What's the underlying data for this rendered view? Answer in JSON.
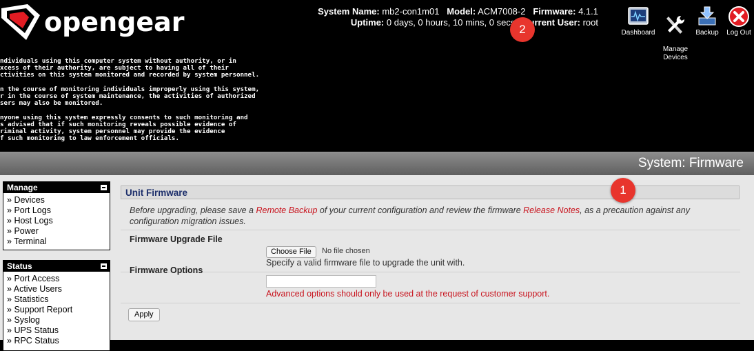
{
  "brand": {
    "name": "opengear"
  },
  "system": {
    "name_label": "System Name:",
    "name_value": "mb2-con1m01",
    "model_label": "Model:",
    "model_value": "ACM7008-2",
    "firmware_label": "Firmware:",
    "firmware_value": "4.1.1",
    "uptime_label": "Uptime:",
    "uptime_value": "0 days, 0 hours, 10 mins, 0 secs",
    "user_label": "Current User:",
    "user_value": "root"
  },
  "toolbar": [
    {
      "label": "Dashboard",
      "icon": "dashboard-icon"
    },
    {
      "label": "Manage\nDevices",
      "icon": "wrench-screwdriver-icon"
    },
    {
      "label": "Backup",
      "icon": "backup-icon"
    },
    {
      "label": "Log Out",
      "icon": "logout-icon"
    }
  ],
  "banner": "ndividuals using this computer system without authority, or in\nxcess of their authority, are subject to having all of their\nctivities on this system monitored and recorded by system personnel.\n\nn the course of monitoring individuals improperly using this system,\nr in the course of system maintenance, the activities of authorized\nsers may also be monitored.\n\nnyone using this system expressly consents to such monitoring and\ns advised that if such monitoring reveals possible evidence of\nriminal activity, system personnel may provide the evidence\nf such monitoring to law enforcement officials.",
  "page_title": "System: Firmware",
  "menus": {
    "manage": {
      "title": "Manage",
      "items": [
        "Devices",
        "Port Logs",
        "Host Logs",
        "Power",
        "Terminal"
      ]
    },
    "status": {
      "title": "Status",
      "items": [
        "Port Access",
        "Active Users",
        "Statistics",
        "Support Report",
        "Syslog",
        "UPS Status",
        "RPC Status"
      ]
    }
  },
  "firmware": {
    "section_title": "Unit Firmware",
    "intro_before": "Before upgrading, please save a ",
    "intro_link1": "Remote Backup",
    "intro_mid": " of your current configuration and review the firmware ",
    "intro_link2": "Release Notes",
    "intro_after": ", as a precaution against any configuration migration issues.",
    "upgrade_label": "Firmware Upgrade File",
    "choose_label": "Choose File",
    "no_file": "No file chosen",
    "upgrade_hint": "Specify a valid firmware file to upgrade the unit with.",
    "options_label": "Firmware Options",
    "options_value": "",
    "options_hint": "Advanced options should only be used at the request of customer support.",
    "apply_label": "Apply"
  },
  "annotations": [
    "1",
    "2"
  ],
  "colors": {
    "accent_red": "#c8141e",
    "badge": "#e8352d",
    "section_title": "#1d2f6b"
  }
}
